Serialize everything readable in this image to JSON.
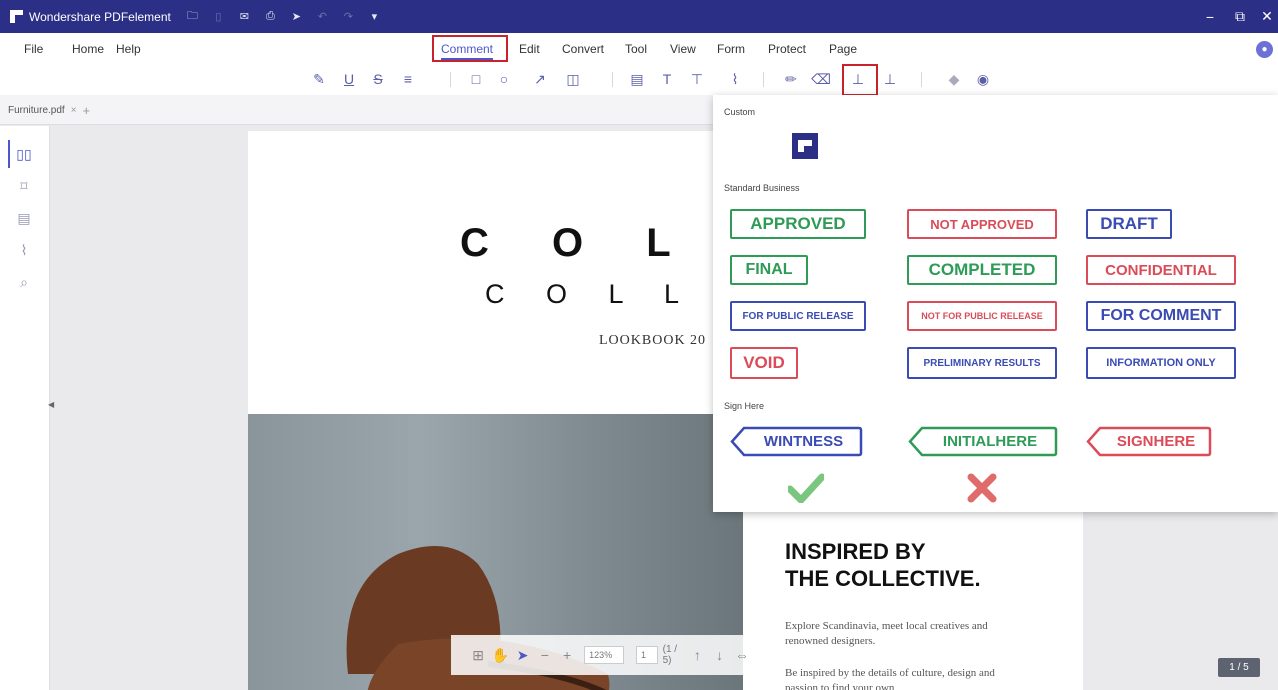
{
  "app": {
    "title": "Wondershare PDFelement"
  },
  "titlebar_icons": [
    "folder-icon",
    "save-icon",
    "mail-icon",
    "print-icon",
    "share-icon",
    "undo-icon",
    "redo-icon",
    "dropdown-icon"
  ],
  "window_controls": {
    "minimize": "−",
    "restore": "⧉",
    "close": "✕"
  },
  "menu": [
    {
      "label": "File"
    },
    {
      "label": "Home"
    },
    {
      "label": "Help"
    },
    {
      "label": "Comment",
      "active": true
    },
    {
      "label": "Edit"
    },
    {
      "label": "Convert"
    },
    {
      "label": "Tool"
    },
    {
      "label": "View"
    },
    {
      "label": "Form"
    },
    {
      "label": "Protect"
    },
    {
      "label": "Page"
    }
  ],
  "toolbar": {
    "icons": [
      "highlight-icon",
      "underline-icon",
      "strikethrough-icon",
      "replace-text-icon",
      "rectangle-icon",
      "circle-icon",
      "arrow-icon",
      "shape-dropdown-icon",
      "sticky-note-icon",
      "text-icon",
      "textbox-icon",
      "attachment-icon",
      "pencil-icon",
      "eraser-icon",
      "stamp-icon",
      "stamp-dropdown-icon",
      "hide-annotations-icon",
      "eye-icon"
    ]
  },
  "tab": {
    "label": "Furniture.pdf",
    "close": "×",
    "new": "+"
  },
  "sidebar": {
    "icons": [
      "thumbnail-icon",
      "bookmark-icon",
      "comment-icon",
      "attachment-icon",
      "search-icon"
    ]
  },
  "document": {
    "title_line1": "C O L U M",
    "title_line2": "C O L L E C",
    "subtitle": "LOOKBOOK 20",
    "heading_line1": "INSPIRED BY",
    "heading_line2": "THE COLLECTIVE.",
    "body1": "Explore Scandinavia, meet local creatives and renowned designers.",
    "body2": "Be inspired by the details of culture, design and passion to find your own"
  },
  "stamps": {
    "custom_heading": "Custom",
    "business_heading": "Standard Business",
    "business": [
      {
        "label": "APPROVED",
        "color": "green"
      },
      {
        "label": "NOT APPROVED",
        "color": "red"
      },
      {
        "label": "DRAFT",
        "color": "blue"
      },
      {
        "label": "FINAL",
        "color": "green"
      },
      {
        "label": "COMPLETED",
        "color": "green"
      },
      {
        "label": "CONFIDENTIAL",
        "color": "red"
      },
      {
        "label": "FOR PUBLIC RELEASE",
        "color": "blue"
      },
      {
        "label": "NOT FOR PUBLIC RELEASE",
        "color": "red"
      },
      {
        "label": "FOR COMMENT",
        "color": "blue"
      },
      {
        "label": "VOID",
        "color": "red"
      },
      {
        "label": "PRELIMINARY RESULTS",
        "color": "blue"
      },
      {
        "label": "INFORMATION ONLY",
        "color": "blue"
      }
    ],
    "sign_heading": "Sign Here",
    "sign": [
      {
        "label": "WINTNESS",
        "color": "blue"
      },
      {
        "label": "INITIALHERE",
        "color": "green"
      },
      {
        "label": "SIGNHERE",
        "color": "red"
      }
    ],
    "marks": [
      {
        "name": "checkmark-icon",
        "color": "#7bc67e"
      },
      {
        "name": "cross-icon",
        "color": "#e06b6b"
      }
    ]
  },
  "colors": {
    "titlebar": "#2b2f85",
    "accent": "#4e56c9",
    "highlight_box": "#c8232c",
    "green": "#2e9b56",
    "red": "#d94c58",
    "blue": "#3a4bb3"
  },
  "zoom": {
    "level": "123%",
    "page_input": "1",
    "page_total": "(1 / 5)"
  },
  "page_indicator": "1 / 5"
}
